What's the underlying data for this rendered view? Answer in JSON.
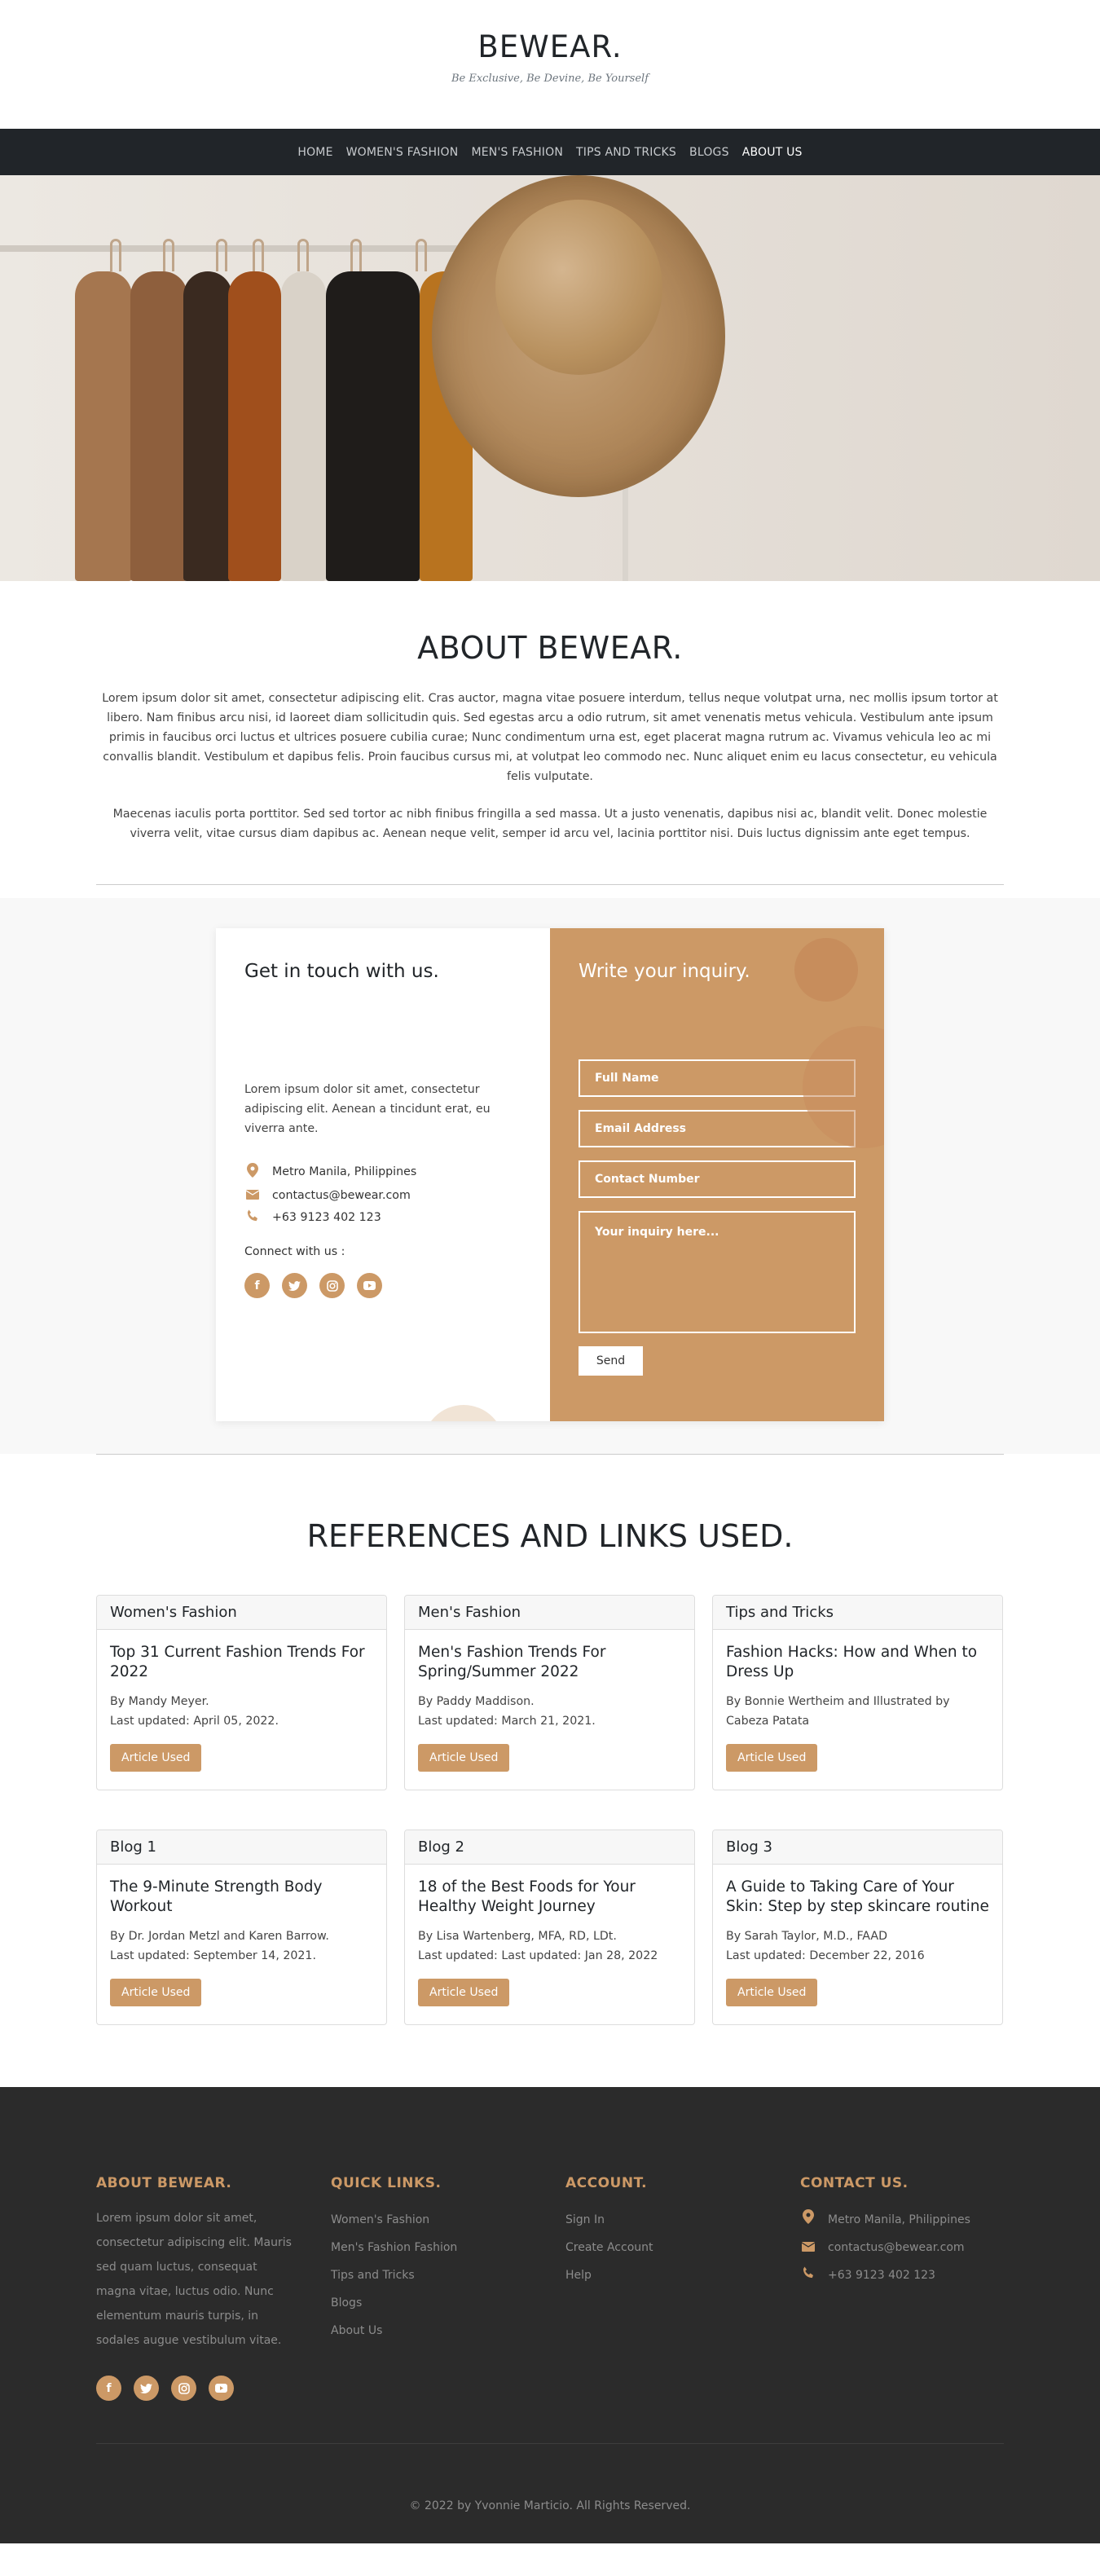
{
  "header": {
    "brand": "BEWEAR.",
    "tagline": "Be Exclusive, Be Devine, Be Yourself"
  },
  "nav": {
    "items": [
      {
        "label": "HOME"
      },
      {
        "label": "WOMEN'S FASHION"
      },
      {
        "label": "MEN'S FASHION"
      },
      {
        "label": "TIPS AND TRICKS"
      },
      {
        "label": "BLOGS"
      },
      {
        "label": "ABOUT US"
      }
    ]
  },
  "about": {
    "title": "ABOUT BEWEAR.",
    "para1": "Lorem ipsum dolor sit amet, consectetur adipiscing elit. Cras auctor, magna vitae posuere interdum, tellus neque volutpat urna, nec mollis ipsum tortor at libero. Nam finibus arcu nisi, id laoreet diam sollicitudin quis. Sed egestas arcu a odio rutrum, sit amet venenatis metus vehicula. Vestibulum ante ipsum primis in faucibus orci luctus et ultrices posuere cubilia curae; Nunc condimentum urna est, eget placerat magna rutrum ac. Vivamus vehicula leo ac mi convallis blandit. Vestibulum et dapibus felis. Proin faucibus cursus mi, at volutpat leo commodo nec. Nunc aliquet enim eu lacus consectetur, eu vehicula felis vulputate.",
    "para2": "Maecenas iaculis porta porttitor. Sed sed tortor ac nibh finibus fringilla a sed massa. Ut a justo venenatis, dapibus nisi ac, blandit velit. Donec molestie viverra velit, vitae cursus diam dapibus ac. Aenean neque velit, semper id arcu vel, lacinia porttitor nisi. Duis luctus dignissim ante eget tempus."
  },
  "contact": {
    "left_title": "Get in touch with us.",
    "description": "Lorem ipsum dolor sit amet, consectetur adipiscing elit. Aenean a tincidunt erat, eu viverra ante.",
    "location": "Metro Manila, Philippines",
    "email": "contactus@bewear.com",
    "phone": "+63 9123 402 123",
    "connect_label": "Connect with us :",
    "right_title": "Write your inquiry.",
    "full_name_placeholder": "Full Name",
    "email_placeholder": "Email Address",
    "contact_number_placeholder": "Contact Number",
    "inquiry_placeholder": "Your inquiry here...",
    "send_label": "Send"
  },
  "references": {
    "title": "REFERENCES AND LINKS USED.",
    "button_label": "Article Used",
    "cards": [
      {
        "category": "Women's Fashion",
        "title": "Top 31 Current Fashion Trends For 2022",
        "author": "By Mandy Meyer.",
        "updated": "Last updated: April 05, 2022."
      },
      {
        "category": "Men's Fashion",
        "title": "Men's Fashion Trends For Spring/Summer 2022",
        "author": "By Paddy Maddison.",
        "updated": "Last updated: March 21, 2021."
      },
      {
        "category": "Tips and Tricks",
        "title": "Fashion Hacks: How and When to Dress Up",
        "author": "By Bonnie Wertheim and Illustrated by Cabeza Patata",
        "updated": ""
      },
      {
        "category": "Blog 1",
        "title": "The 9-Minute Strength Body Workout",
        "author": "By Dr. Jordan Metzl and Karen Barrow.",
        "updated": "Last updated: September 14, 2021."
      },
      {
        "category": "Blog 2",
        "title": "18 of the Best Foods for Your Healthy Weight Journey",
        "author": "By Lisa Wartenberg, MFA, RD, LDt.",
        "updated": "Last updated: Last updated: Jan 28, 2022"
      },
      {
        "category": "Blog 3",
        "title": "A Guide to Taking Care of Your Skin: Step by step skincare routine",
        "author": "By Sarah Taylor, M.D., FAAD",
        "updated": "Last updated: December 22, 2016"
      }
    ]
  },
  "footer": {
    "about_title": "ABOUT BEWEAR.",
    "about_text": "Lorem ipsum dolor sit amet, consectetur adipiscing elit. Mauris sed quam luctus, consequat magna vitae, luctus odio. Nunc elementum mauris turpis, in sodales augue vestibulum vitae.",
    "links_title": "QUICK LINKS.",
    "links": [
      "Women's Fashion",
      "Men's Fashion Fashion",
      "Tips and Tricks",
      "Blogs",
      "About Us"
    ],
    "account_title": "ACCOUNT.",
    "account_links": [
      "Sign In",
      "Create Account",
      "Help"
    ],
    "contact_title": "CONTACT US.",
    "location": "Metro Manila, Philippines",
    "email": "contactus@bewear.com",
    "phone": "+63 9123 402 123",
    "copyright": "© 2022 by Yvonnie Marticio. All Rights Reserved."
  },
  "colors": {
    "accent": "#cc9966",
    "nav_bg": "#212529",
    "footer_bg": "#2b2b2b"
  },
  "icons": [
    "location-icon",
    "email-icon",
    "phone-icon",
    "facebook-icon",
    "twitter-icon",
    "instagram-icon",
    "youtube-icon"
  ]
}
